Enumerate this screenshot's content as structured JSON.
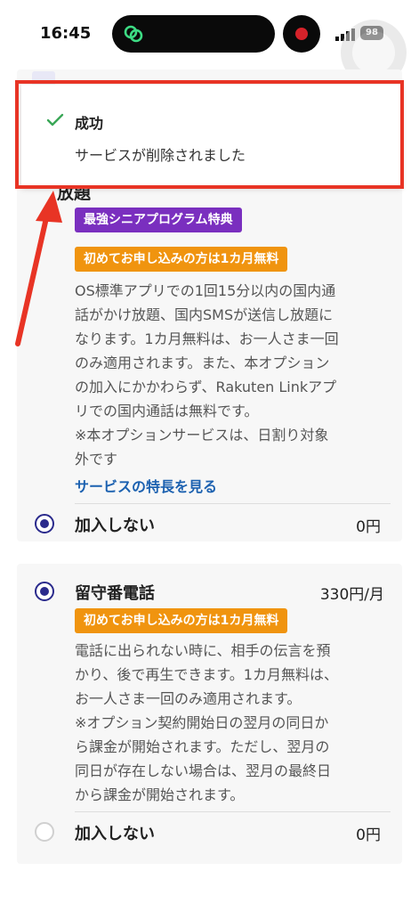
{
  "status_bar": {
    "time": "16:45",
    "battery": "98"
  },
  "toast": {
    "title": "成功",
    "message": "サービスが削除されました"
  },
  "service1": {
    "title_fragment": "放題",
    "badge_special": "最強シニアプログラム特典",
    "badge_free": "初めてお申し込みの方は1カ月無料",
    "description_lines": [
      "OS標準アプリでの1回15分以内の国内通",
      "話がかけ放題、国内SMSが送信し放題に",
      "なります。1カ月無料は、お一人さま一回",
      "のみ適用されます。また、本オプション",
      "の加入にかかわらず、Rakuten Linkアプ",
      "リでの国内通話は無料です。",
      "※本オプションサービスは、日割り対象",
      "外です"
    ],
    "features_link": "サービスの特長を見る",
    "decline_label": "加入しない",
    "decline_price": "0円"
  },
  "service2": {
    "name": "留守番電話",
    "price": "330円/月",
    "badge_free": "初めてお申し込みの方は1カ月無料",
    "description_lines": [
      "電話に出られない時に、相手の伝言を預",
      "かり、後で再生できます。1カ月無料は、",
      "お一人さま一回のみ適用されます。",
      "※オプション契約開始日の翌月の同日か",
      "ら課金が開始されます。ただし、翌月の",
      "同日が存在しない場合は、翌月の最終日",
      "から課金が開始されます。"
    ],
    "decline_label": "加入しない",
    "decline_price": "0円"
  },
  "colors": {
    "accent_purple": "#7a2fbf",
    "accent_orange": "#f0940f",
    "link_blue": "#1c61b0",
    "annotation_red": "#e83425",
    "success_green": "#3aa757"
  }
}
